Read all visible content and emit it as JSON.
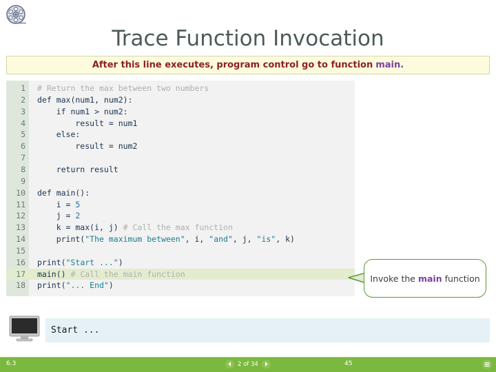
{
  "logo": {
    "icon": "film-reel-icon"
  },
  "title": "Trace Function Invocation",
  "banner": {
    "text": "After this line executes, program control go to function ",
    "accent": "main.",
    "bg_color": "#fcfbdd",
    "text_color": "#8e2020",
    "accent_color": "#7b3f9d"
  },
  "code": {
    "highlight_line": 17,
    "lines": [
      {
        "n": "1",
        "text": "# Return the max between two numbers",
        "kind": "comment"
      },
      {
        "n": "2",
        "text": "def max(num1, num2):",
        "kind": "code"
      },
      {
        "n": "3",
        "text": "    if num1 > num2:",
        "kind": "code"
      },
      {
        "n": "4",
        "text": "        result = num1",
        "kind": "code"
      },
      {
        "n": "5",
        "text": "    else:",
        "kind": "code"
      },
      {
        "n": "6",
        "text": "        result = num2",
        "kind": "code"
      },
      {
        "n": "7",
        "text": "",
        "kind": "code"
      },
      {
        "n": "8",
        "text": "    return result",
        "kind": "code"
      },
      {
        "n": "9",
        "text": "",
        "kind": "code"
      },
      {
        "n": "10",
        "text": "def main():",
        "kind": "code"
      },
      {
        "n": "11",
        "text": "    i = 5",
        "kind": "code"
      },
      {
        "n": "12",
        "text": "    j = 2",
        "kind": "code"
      },
      {
        "n": "13",
        "text": "    k = max(i, j) # Call the max function",
        "kind": "mixed",
        "code_part": "    k = max(i, j) ",
        "comment_part": "# Call the max function"
      },
      {
        "n": "14",
        "text": "    print(\"The maximum between\", i, \"and\", j, \"is\", k)",
        "kind": "string-mixed"
      },
      {
        "n": "15",
        "text": "",
        "kind": "code"
      },
      {
        "n": "16",
        "text": "print(\"Start ...\")",
        "kind": "string-mixed"
      },
      {
        "n": "17",
        "text": "main() # Call the main function",
        "kind": "mixed",
        "code_part": "main() ",
        "comment_part": "# Call the main function"
      },
      {
        "n": "18",
        "text": "print(\"... End\")",
        "kind": "string-mixed"
      }
    ]
  },
  "callout": {
    "text": "Invoke the ",
    "accent": "main",
    "text2": " function",
    "border_color": "#5e9732",
    "accent_color": "#7b3f9d"
  },
  "console": {
    "icon": "monitor-icon",
    "output": "Start ...",
    "bg_color": "#e5f1f6"
  },
  "footer": {
    "section": "6.3",
    "prev_label": "previous",
    "page_counter": "2 of 34",
    "next_label": "next",
    "page_number": "45",
    "menu_label": "menu",
    "bg_color": "#7ab83f"
  }
}
